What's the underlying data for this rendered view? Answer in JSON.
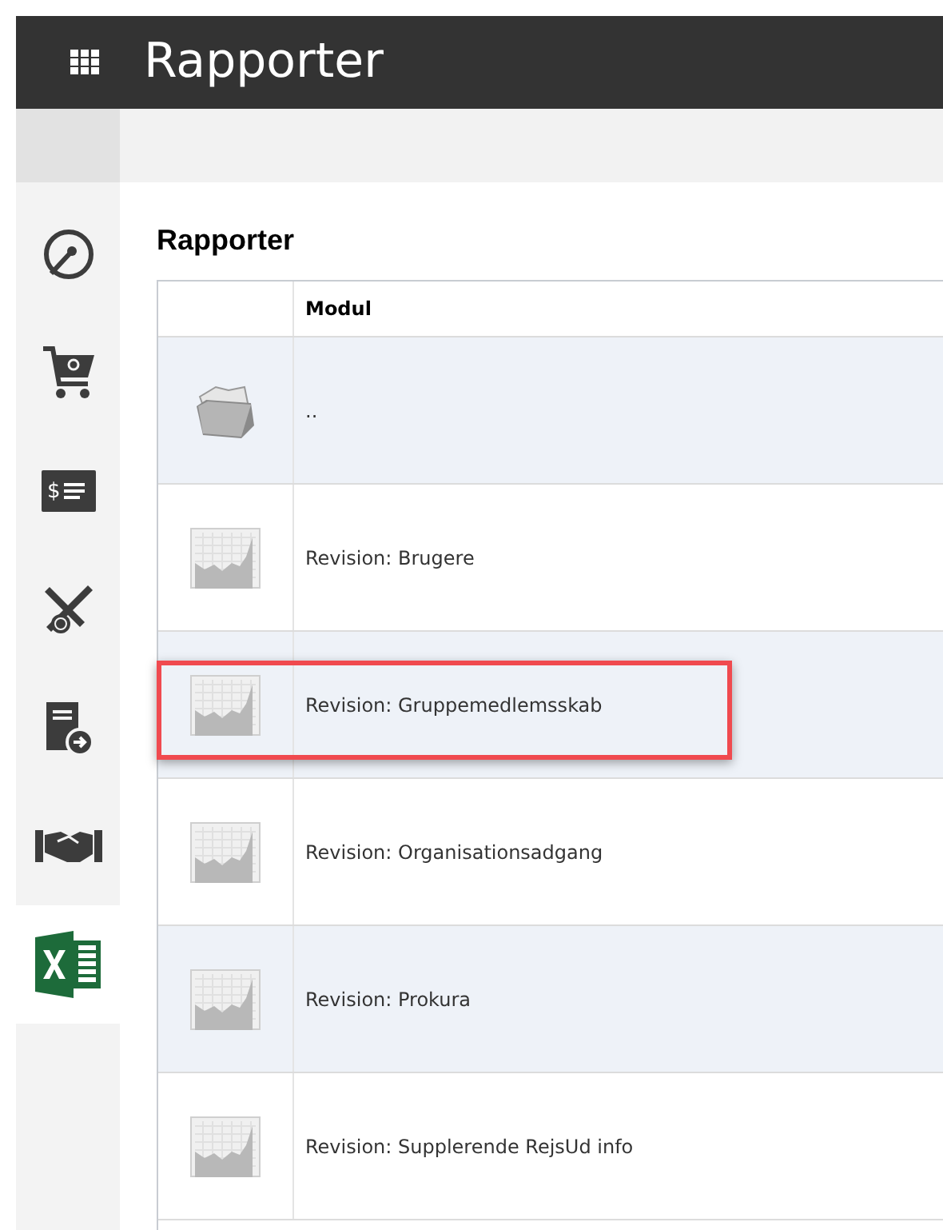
{
  "header": {
    "title": "Rapporter"
  },
  "sidebar": {
    "items": [
      {
        "kind": "gauge",
        "selected": false
      },
      {
        "kind": "cart",
        "selected": false
      },
      {
        "kind": "invoice",
        "glyph": "$",
        "selected": false
      },
      {
        "kind": "travel",
        "selected": false
      },
      {
        "kind": "document",
        "selected": false
      },
      {
        "kind": "handshake",
        "selected": false
      },
      {
        "kind": "excel",
        "selected": true
      }
    ]
  },
  "page_title": "Rapporter",
  "table": {
    "columns": [
      "Modul"
    ],
    "rows": [
      {
        "kind": "folder",
        "name": "..",
        "highlighted": false
      },
      {
        "kind": "report",
        "name": "Revision: Brugere",
        "highlighted": false
      },
      {
        "kind": "report",
        "name": "Revision: Gruppemedlemsskab",
        "highlighted": true
      },
      {
        "kind": "report",
        "name": "Revision: Organisationsadgang",
        "highlighted": false
      },
      {
        "kind": "report",
        "name": "Revision: Prokura",
        "highlighted": false
      },
      {
        "kind": "report",
        "name": "Revision: Supplerende RejsUd info",
        "highlighted": false
      }
    ]
  }
}
